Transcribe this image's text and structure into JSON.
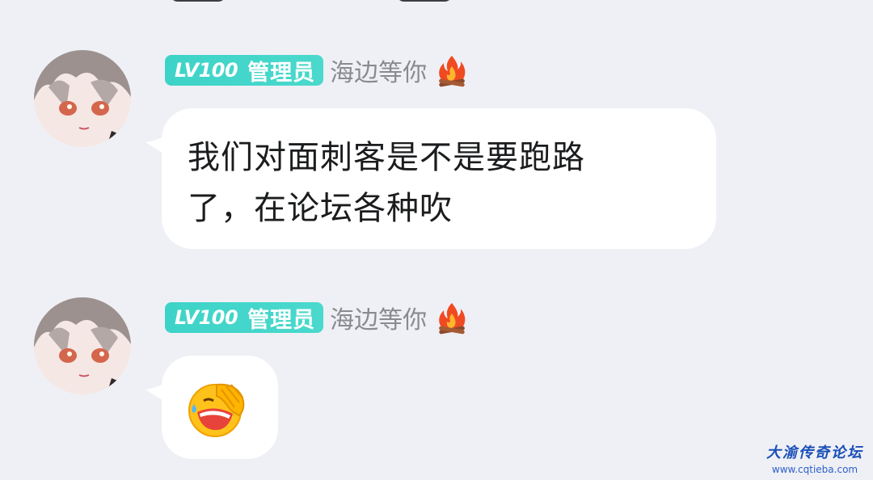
{
  "app": {
    "background": "#eff0f5"
  },
  "messages": [
    {
      "user": {
        "level": "LV100",
        "role": "管理员",
        "nickname": "海边等你",
        "status_icon": "campfire-icon"
      },
      "content_type": "text",
      "text_lines": [
        "我们对面刺客是不是要跑路",
        "了，在论坛各种吹"
      ]
    },
    {
      "user": {
        "level": "LV100",
        "role": "管理员",
        "nickname": "海边等你",
        "status_icon": "campfire-icon"
      },
      "content_type": "emoji",
      "emoji": "facepalm-laugh-emoji"
    }
  ],
  "watermark": {
    "title": "大渝传奇论坛",
    "url": "www.cqtieba.com"
  },
  "colors": {
    "badge": "#3ed3c8",
    "nickname": "#8a8b91",
    "bubble": "#ffffff",
    "watermark": "#1a4fb8"
  }
}
